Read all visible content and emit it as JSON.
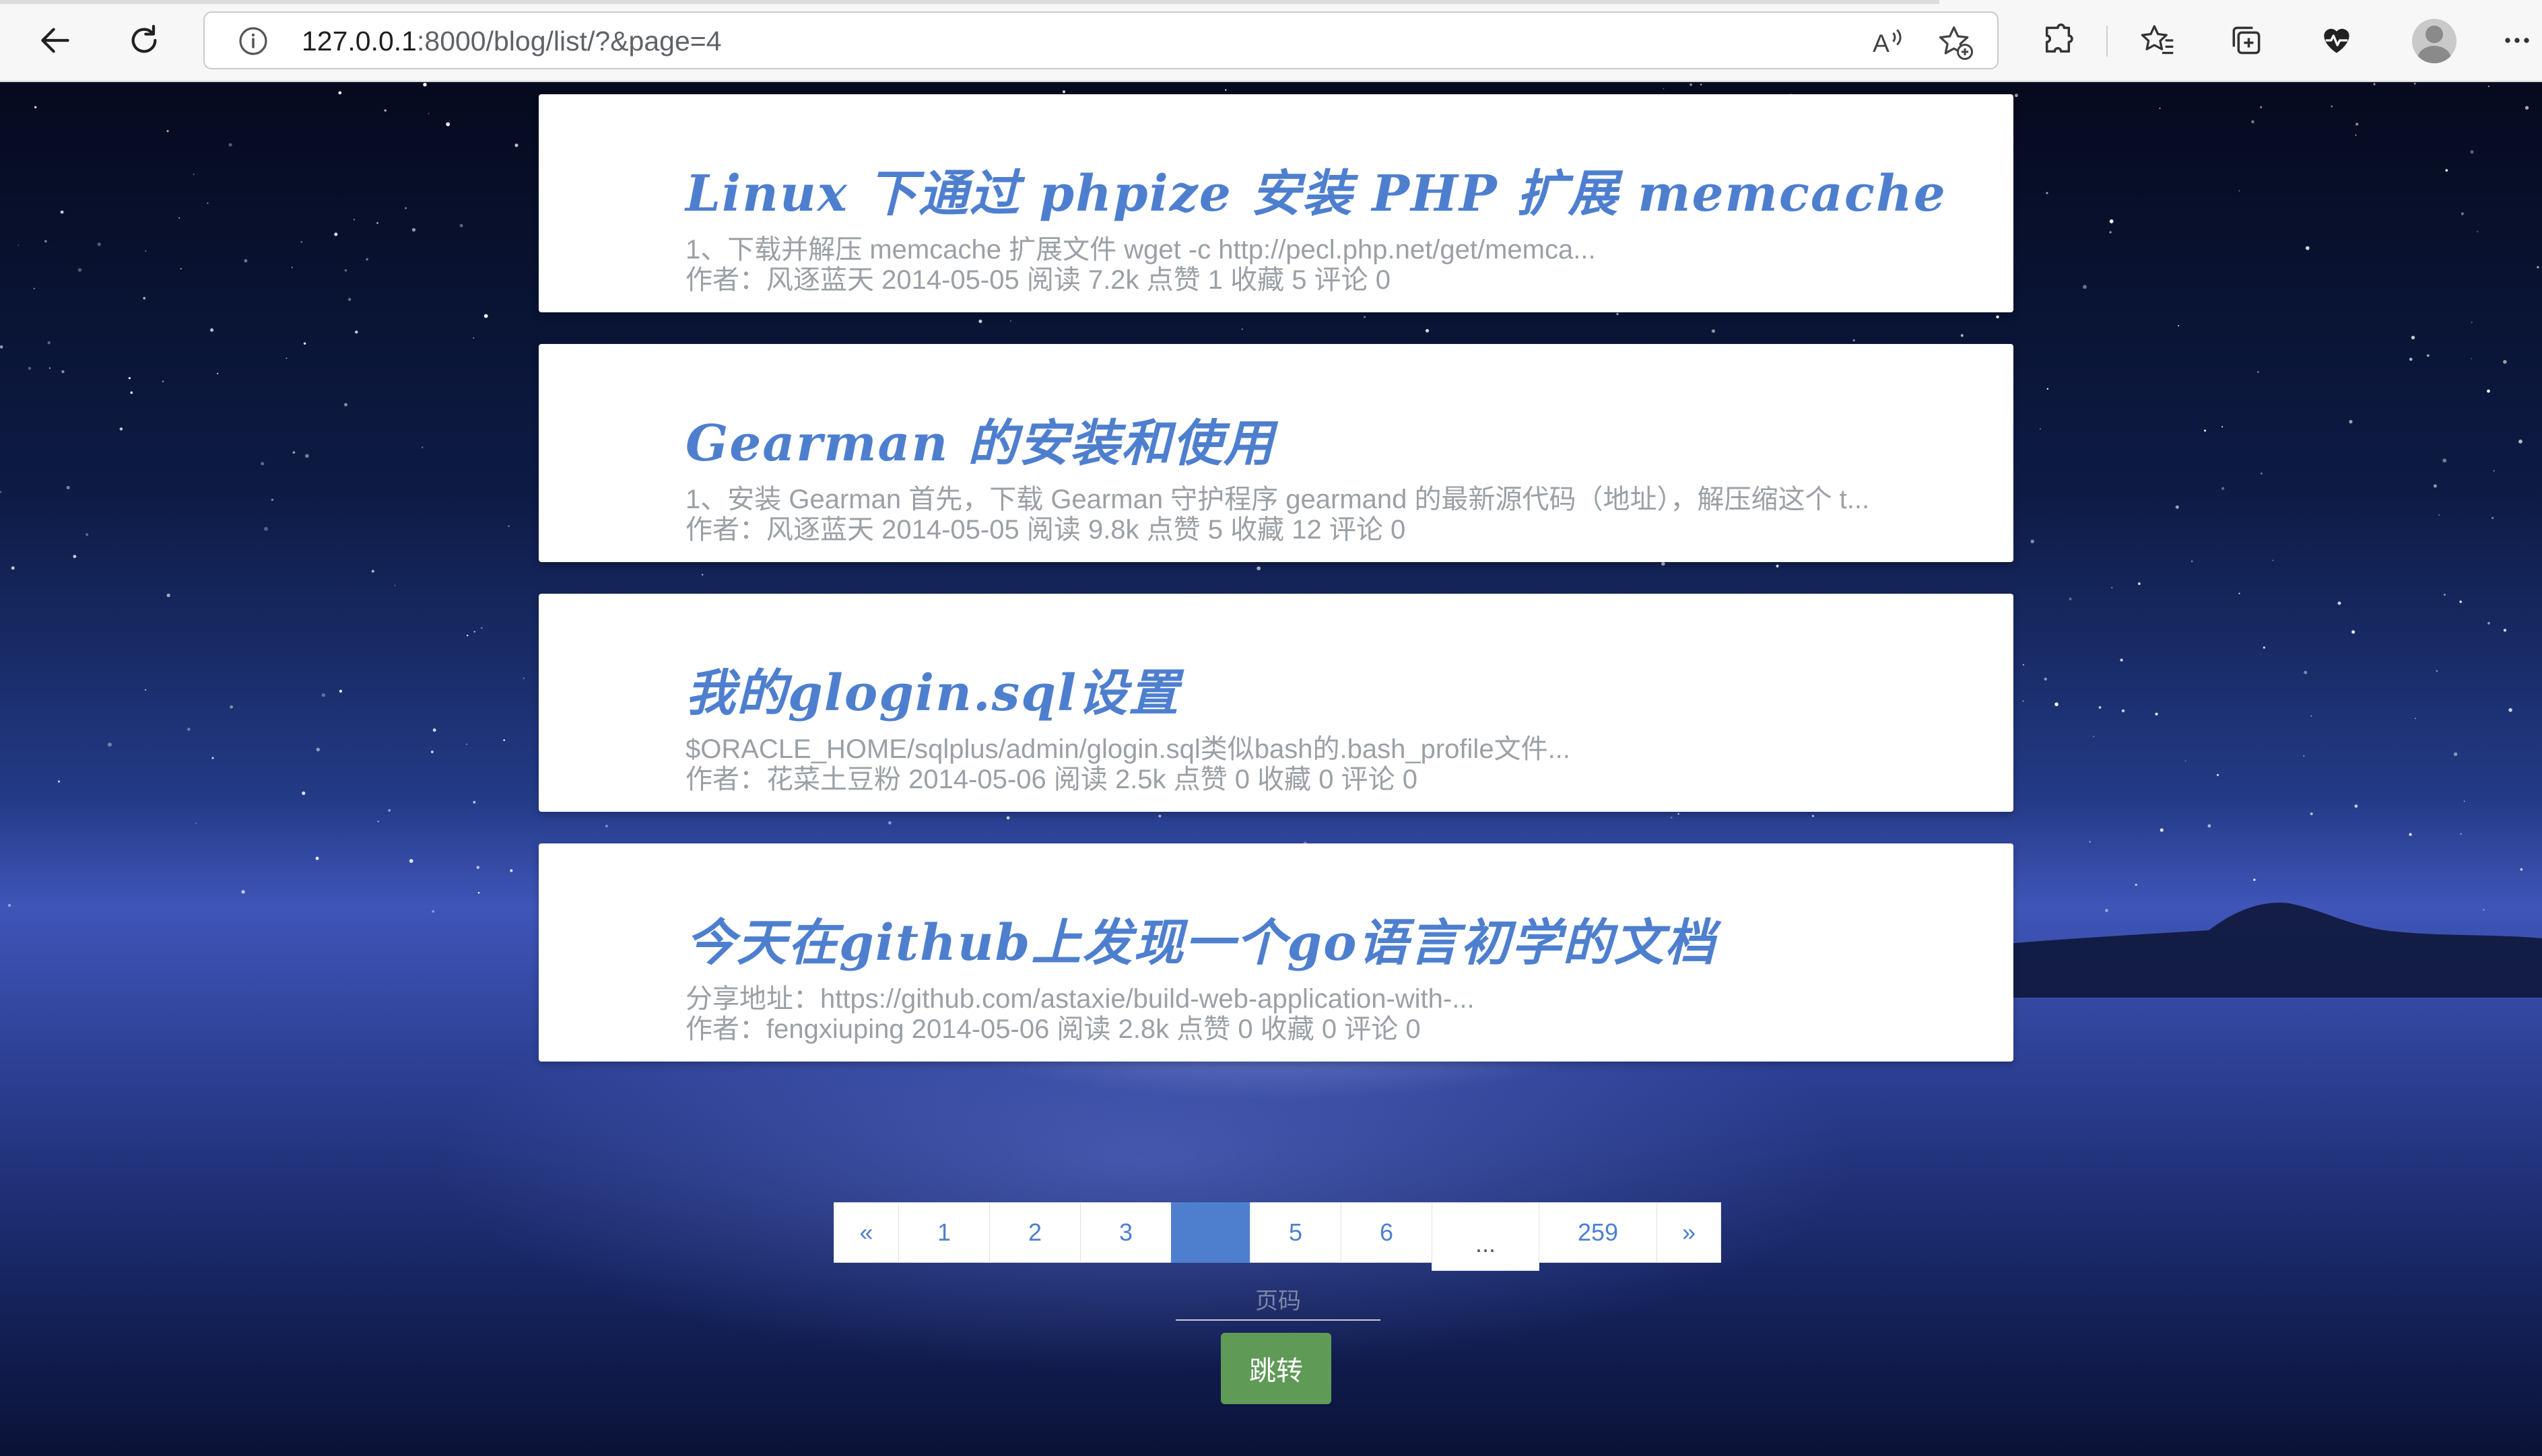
{
  "browser": {
    "url_host": "127.0.0.1",
    "url_rest": ":8000/blog/list/?&page=4"
  },
  "posts": [
    {
      "title": "Linux 下通过 phpize 安装 PHP 扩展 memcache",
      "summary": "1、下载并解压 memcache 扩展文件 wget -c http://pecl.php.net/get/memca...",
      "meta": "作者：风逐蓝天 2014-05-05 阅读 7.2k 点赞 1 收藏 5 评论 0"
    },
    {
      "title": "Gearman 的安装和使用",
      "summary": "1、安装 Gearman 首先，下载 Gearman 守护程序 gearmand 的最新源代码（地址），解压缩这个 t...",
      "meta": "作者：风逐蓝天 2014-05-05 阅读 9.8k 点赞 5 收藏 12 评论 0"
    },
    {
      "title": "我的glogin.sql设置",
      "summary": "$ORACLE_HOME/sqlplus/admin/glogin.sql类似bash的.bash_profile文件...",
      "meta": "作者：花菜土豆粉 2014-05-06 阅读 2.5k 点赞 0 收藏 0 评论 0"
    },
    {
      "title": "今天在github上发现一个go语言初学的文档",
      "summary": "分享地址：https://github.com/astaxie/build-web-application-with-...",
      "meta": "作者：fengxiuping 2014-05-06 阅读 2.8k 点赞 0 收藏 0 评论 0"
    }
  ],
  "pagination": {
    "prev": "«",
    "pages": [
      "1",
      "2",
      "3",
      "",
      "5",
      "6"
    ],
    "ellipsis": "...",
    "last": "259",
    "next": "»",
    "current_page": 4
  },
  "jump": {
    "placeholder": "页码",
    "button": "跳转"
  },
  "colors": {
    "accent": "#4e7fcf",
    "jump_button": "#5f9a57",
    "muted_text": "#9aa0a6"
  }
}
